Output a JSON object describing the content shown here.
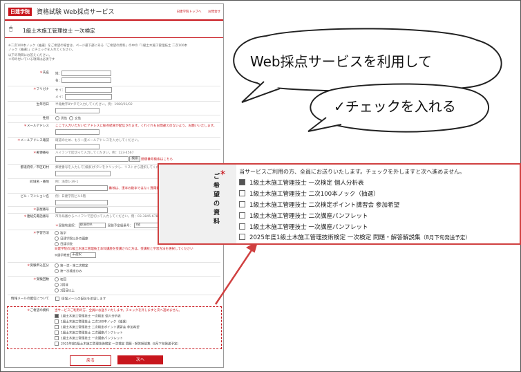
{
  "header": {
    "logo": "日建学院",
    "site_title": "資格試験 Web採点サービス",
    "links": [
      "日建学院トップへ",
      "お問合せ"
    ]
  },
  "exam_title": "1級土木施工管理技士 一次検定",
  "intro": {
    "line1": "※二次100本ノック（抽選）をご希望の場合は、ページ最下部にある「ご希望の資料」の中の「1級土木施工管理技士 二次100本",
    "line2": "ノック（抽選）」にチェックを入れてください。",
    "line3": "以下の項目にお答えください。",
    "line4": "＊印の付いている項目は必須です"
  },
  "fields": {
    "name": {
      "label": "氏名",
      "sei": "姓：",
      "mei": "名："
    },
    "furigana": {
      "label": "フリガナ",
      "sei": "セイ：",
      "mei": "メイ："
    },
    "birth": {
      "label": "生年月日",
      "hint": "半角数字8ケタで入力してください。例：1980/01/02"
    },
    "gender": {
      "label": "性別",
      "male": "男性",
      "female": "女性"
    },
    "email": {
      "label": "メールアドレス",
      "hint": "ここで入力いただいたアドレスに採点結果が配信されます。くれぐれもお間違えのないよう、お願いいたします。"
    },
    "email_confirm": {
      "label": "メールアドレス確認",
      "hint": "確認のため、もう一度メールアドレスを入力してください。"
    },
    "zip": {
      "label": "郵便番号",
      "hint": "ハイフンで区切って入力してください。例：123-4567",
      "search_btn": "検索",
      "search_link": "郵便番号検索はこちら"
    },
    "pref": {
      "label": "都道府県／市区町村",
      "hint": "郵便番号を入力して[検索]ボタンをクリックし、リストから選択してください。"
    },
    "street": {
      "label": "町域名・番地",
      "example": "例：浅草1-39-1",
      "hint": "番地は、漢字の数字ではなく算用数字でご入力ください。"
    },
    "building": {
      "label": "ビル・マンション名",
      "example": "例：日建学院ビル5階"
    },
    "room": {
      "label": "部屋番号"
    },
    "phone": {
      "label": "連絡先電話番号",
      "hint": "市外局番からハイフンで区切って入力してください。例：03-3845-6789"
    },
    "venue": {
      "label1": "受験地選択：",
      "value1": "都道府県",
      "label2": "受験予定級番号：",
      "value2": "1級"
    },
    "school": {
      "label": "学習方法",
      "o1": "独学",
      "o2": "日建学院以外の講座",
      "o3": "日建学院",
      "sub": "日建学院の1級土木施工管理技士本科講座を受講された方は、受講校と学習方法を選択してください",
      "sub2": "※通学教室",
      "sub2_value": "未選択"
    },
    "apply": {
      "label": "受験申込区分",
      "o1": "第一次・第二次検定",
      "o2": "第一次検定のみ"
    },
    "times": {
      "label": "受験回数",
      "o1": "初回",
      "o2": "2回目",
      "o3": "3回目以上"
    },
    "mail": {
      "label": "情報メールの配信について",
      "opt": "情報メールの配信を希望します"
    }
  },
  "materials": {
    "label": "ご希望の資料",
    "note": "当サービスご利用の方、全員にお送りいたします。チェックを外しますと次へ進めません。",
    "items": [
      {
        "text": "1級土木施工管理技士 一次検定 個人分析表",
        "checked": true
      },
      {
        "text": "1級土木施工管理技士 二次100本ノック（抽選）",
        "checked": false
      },
      {
        "text": "1級土木施工管理技士 二次検定ポイント講習会 参加希望",
        "checked": false
      },
      {
        "text": "1級土木施工管理技士 二次講座パンフレット",
        "checked": false
      },
      {
        "text": "1級土木施工管理技士 一次講座パンフレット",
        "checked": false
      },
      {
        "text": "2025年度1級土木施工管理技術検定 一次検定 問題・解答解説集",
        "sub": "（8月下旬発送予定）",
        "checked": false
      }
    ]
  },
  "buttons": {
    "back": "戻る",
    "next": "次へ"
  },
  "callouts": {
    "bubble1": "Web採点サービスを利用して",
    "bubble2": "✓チェックを入れる"
  },
  "colors": {
    "brand": "#c8161d",
    "callout_line": "#d04040"
  }
}
